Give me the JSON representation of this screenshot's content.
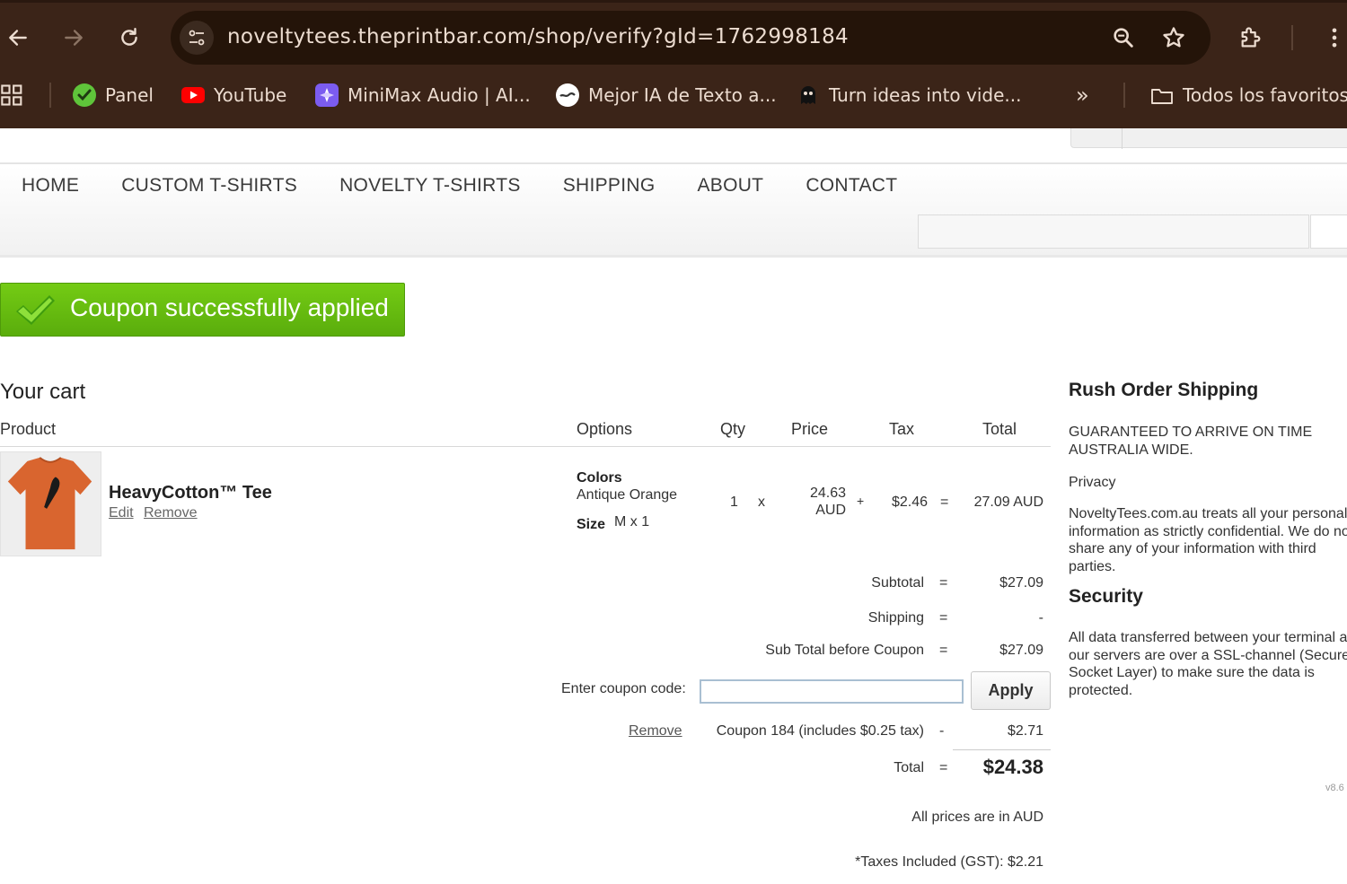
{
  "browser": {
    "url": "noveltytees.theprintbar.com/shop/verify?gId=1762998184",
    "bookmarks": [
      {
        "label": "Panel",
        "icon": "panel-icon"
      },
      {
        "label": "YouTube",
        "icon": "youtube-icon"
      },
      {
        "label": "MiniMax Audio | AI...",
        "icon": "minimax-icon"
      },
      {
        "label": "Mejor IA de Texto a...",
        "icon": "globe-icon"
      },
      {
        "label": "Turn ideas into vide...",
        "icon": "ghost-icon"
      }
    ],
    "more_label": "»",
    "all_bookmarks_label": "Todos los favoritos"
  },
  "nav": {
    "items": [
      "HOME",
      "CUSTOM T-SHIRTS",
      "NOVELTY T-SHIRTS",
      "SHIPPING",
      "ABOUT",
      "CONTACT"
    ]
  },
  "banner": {
    "message": "Coupon successfully applied",
    "color": "#6cc212"
  },
  "cart": {
    "title": "Your cart",
    "headers": {
      "product": "Product",
      "options": "Options",
      "qty": "Qty",
      "price": "Price",
      "tax": "Tax",
      "total": "Total"
    },
    "item": {
      "name": "HeavyCotton™ Tee",
      "edit": "Edit",
      "remove": "Remove",
      "color_label": "Colors",
      "color_value": "Antique Orange",
      "size_label": "Size",
      "size_value": "M x 1",
      "qty": "1",
      "times": "x",
      "price_line1": "24.63",
      "price_line2": "AUD",
      "plus": "+",
      "tax": "$2.46",
      "equals": "=",
      "total": "27.09 AUD",
      "shirt_color": "#d9652f"
    },
    "totals": {
      "subtotal_label": "Subtotal",
      "subtotal": "$27.09",
      "shipping_label": "Shipping",
      "shipping": "-",
      "before_coupon_label": "Sub Total before Coupon",
      "before_coupon": "$27.09",
      "eq": "=",
      "minus": "-",
      "coupon_label": "Enter coupon code:",
      "coupon_placeholder": "",
      "apply": "Apply",
      "coupon_remove": "Remove",
      "coupon_desc": "Coupon 184 (includes $0.25 tax)",
      "coupon_amount": "$2.71",
      "total_label": "Total",
      "total": "$24.38"
    },
    "notes": {
      "prices": "All prices are in AUD",
      "taxes": "*Taxes Included (GST): $2.21"
    }
  },
  "sidebar": {
    "rush_title": "Rush Order Shipping",
    "rush_text": "GUARANTEED TO ARRIVE ON TIME AUSTRALIA WIDE.",
    "privacy_title": "Privacy",
    "privacy_text": "NoveltyTees.com.au treats all your personal information as strictly confidential. We do not share any of your information with third parties.",
    "security_title": "Security",
    "security_text": "All data transferred between your terminal and our servers are over a SSL-channel (Secure Socket Layer) to make sure the data is protected.",
    "version": "v8.6"
  }
}
